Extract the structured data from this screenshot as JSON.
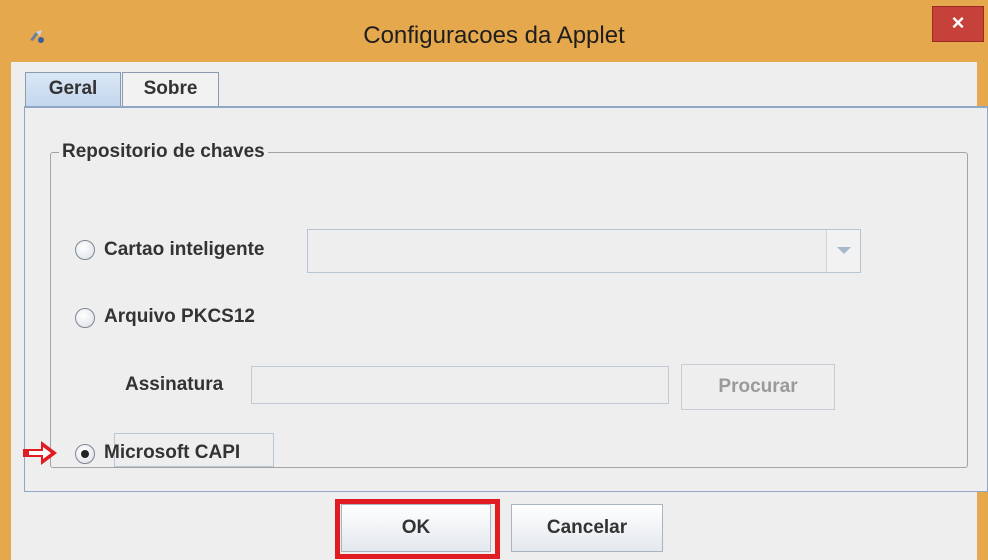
{
  "window": {
    "title": "Configuracoes da Applet",
    "close_label": "×"
  },
  "tabs": [
    {
      "label": "Geral",
      "active": true
    },
    {
      "label": "Sobre",
      "active": false
    }
  ],
  "group": {
    "title": "Repositorio de chaves",
    "options": [
      {
        "label": "Cartao inteligente",
        "selected": false
      },
      {
        "label": "Arquivo PKCS12",
        "selected": false
      },
      {
        "label": "Microsoft CAPI",
        "selected": true
      }
    ],
    "smartcard_dropdown": {
      "value": ""
    },
    "assinatura": {
      "label": "Assinatura",
      "value": "",
      "browse_label": "Procurar"
    }
  },
  "buttons": {
    "ok": "OK",
    "cancel": "Cancelar"
  },
  "colors": {
    "frame": "#e6a84d",
    "close": "#c7413b",
    "highlight": "#e11b22",
    "panel_border": "#8fa6c4"
  }
}
